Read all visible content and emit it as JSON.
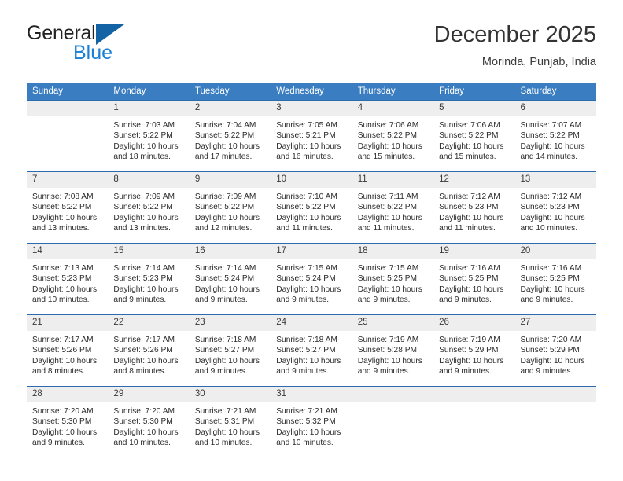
{
  "brand": {
    "line1": "General",
    "line2": "Blue",
    "triangle_color": "#1464a5",
    "blue_text_color": "#1b7fd4"
  },
  "header": {
    "title": "December 2025",
    "subtitle": "Morinda, Punjab, India"
  },
  "theme": {
    "header_bar_color": "#3a7dc0",
    "row_divider_color": "#2c6cae",
    "daynum_band_color": "#eeeeee"
  },
  "weekday_headers": [
    "Sunday",
    "Monday",
    "Tuesday",
    "Wednesday",
    "Thursday",
    "Friday",
    "Saturday"
  ],
  "weeks": [
    [
      {
        "day": "",
        "sunrise": "",
        "sunset": "",
        "daylight": ""
      },
      {
        "day": "1",
        "sunrise": "Sunrise: 7:03 AM",
        "sunset": "Sunset: 5:22 PM",
        "daylight": "Daylight: 10 hours and 18 minutes."
      },
      {
        "day": "2",
        "sunrise": "Sunrise: 7:04 AM",
        "sunset": "Sunset: 5:22 PM",
        "daylight": "Daylight: 10 hours and 17 minutes."
      },
      {
        "day": "3",
        "sunrise": "Sunrise: 7:05 AM",
        "sunset": "Sunset: 5:21 PM",
        "daylight": "Daylight: 10 hours and 16 minutes."
      },
      {
        "day": "4",
        "sunrise": "Sunrise: 7:06 AM",
        "sunset": "Sunset: 5:22 PM",
        "daylight": "Daylight: 10 hours and 15 minutes."
      },
      {
        "day": "5",
        "sunrise": "Sunrise: 7:06 AM",
        "sunset": "Sunset: 5:22 PM",
        "daylight": "Daylight: 10 hours and 15 minutes."
      },
      {
        "day": "6",
        "sunrise": "Sunrise: 7:07 AM",
        "sunset": "Sunset: 5:22 PM",
        "daylight": "Daylight: 10 hours and 14 minutes."
      }
    ],
    [
      {
        "day": "7",
        "sunrise": "Sunrise: 7:08 AM",
        "sunset": "Sunset: 5:22 PM",
        "daylight": "Daylight: 10 hours and 13 minutes."
      },
      {
        "day": "8",
        "sunrise": "Sunrise: 7:09 AM",
        "sunset": "Sunset: 5:22 PM",
        "daylight": "Daylight: 10 hours and 13 minutes."
      },
      {
        "day": "9",
        "sunrise": "Sunrise: 7:09 AM",
        "sunset": "Sunset: 5:22 PM",
        "daylight": "Daylight: 10 hours and 12 minutes."
      },
      {
        "day": "10",
        "sunrise": "Sunrise: 7:10 AM",
        "sunset": "Sunset: 5:22 PM",
        "daylight": "Daylight: 10 hours and 11 minutes."
      },
      {
        "day": "11",
        "sunrise": "Sunrise: 7:11 AM",
        "sunset": "Sunset: 5:22 PM",
        "daylight": "Daylight: 10 hours and 11 minutes."
      },
      {
        "day": "12",
        "sunrise": "Sunrise: 7:12 AM",
        "sunset": "Sunset: 5:23 PM",
        "daylight": "Daylight: 10 hours and 11 minutes."
      },
      {
        "day": "13",
        "sunrise": "Sunrise: 7:12 AM",
        "sunset": "Sunset: 5:23 PM",
        "daylight": "Daylight: 10 hours and 10 minutes."
      }
    ],
    [
      {
        "day": "14",
        "sunrise": "Sunrise: 7:13 AM",
        "sunset": "Sunset: 5:23 PM",
        "daylight": "Daylight: 10 hours and 10 minutes."
      },
      {
        "day": "15",
        "sunrise": "Sunrise: 7:14 AM",
        "sunset": "Sunset: 5:23 PM",
        "daylight": "Daylight: 10 hours and 9 minutes."
      },
      {
        "day": "16",
        "sunrise": "Sunrise: 7:14 AM",
        "sunset": "Sunset: 5:24 PM",
        "daylight": "Daylight: 10 hours and 9 minutes."
      },
      {
        "day": "17",
        "sunrise": "Sunrise: 7:15 AM",
        "sunset": "Sunset: 5:24 PM",
        "daylight": "Daylight: 10 hours and 9 minutes."
      },
      {
        "day": "18",
        "sunrise": "Sunrise: 7:15 AM",
        "sunset": "Sunset: 5:25 PM",
        "daylight": "Daylight: 10 hours and 9 minutes."
      },
      {
        "day": "19",
        "sunrise": "Sunrise: 7:16 AM",
        "sunset": "Sunset: 5:25 PM",
        "daylight": "Daylight: 10 hours and 9 minutes."
      },
      {
        "day": "20",
        "sunrise": "Sunrise: 7:16 AM",
        "sunset": "Sunset: 5:25 PM",
        "daylight": "Daylight: 10 hours and 9 minutes."
      }
    ],
    [
      {
        "day": "21",
        "sunrise": "Sunrise: 7:17 AM",
        "sunset": "Sunset: 5:26 PM",
        "daylight": "Daylight: 10 hours and 8 minutes."
      },
      {
        "day": "22",
        "sunrise": "Sunrise: 7:17 AM",
        "sunset": "Sunset: 5:26 PM",
        "daylight": "Daylight: 10 hours and 8 minutes."
      },
      {
        "day": "23",
        "sunrise": "Sunrise: 7:18 AM",
        "sunset": "Sunset: 5:27 PM",
        "daylight": "Daylight: 10 hours and 9 minutes."
      },
      {
        "day": "24",
        "sunrise": "Sunrise: 7:18 AM",
        "sunset": "Sunset: 5:27 PM",
        "daylight": "Daylight: 10 hours and 9 minutes."
      },
      {
        "day": "25",
        "sunrise": "Sunrise: 7:19 AM",
        "sunset": "Sunset: 5:28 PM",
        "daylight": "Daylight: 10 hours and 9 minutes."
      },
      {
        "day": "26",
        "sunrise": "Sunrise: 7:19 AM",
        "sunset": "Sunset: 5:29 PM",
        "daylight": "Daylight: 10 hours and 9 minutes."
      },
      {
        "day": "27",
        "sunrise": "Sunrise: 7:20 AM",
        "sunset": "Sunset: 5:29 PM",
        "daylight": "Daylight: 10 hours and 9 minutes."
      }
    ],
    [
      {
        "day": "28",
        "sunrise": "Sunrise: 7:20 AM",
        "sunset": "Sunset: 5:30 PM",
        "daylight": "Daylight: 10 hours and 9 minutes."
      },
      {
        "day": "29",
        "sunrise": "Sunrise: 7:20 AM",
        "sunset": "Sunset: 5:30 PM",
        "daylight": "Daylight: 10 hours and 10 minutes."
      },
      {
        "day": "30",
        "sunrise": "Sunrise: 7:21 AM",
        "sunset": "Sunset: 5:31 PM",
        "daylight": "Daylight: 10 hours and 10 minutes."
      },
      {
        "day": "31",
        "sunrise": "Sunrise: 7:21 AM",
        "sunset": "Sunset: 5:32 PM",
        "daylight": "Daylight: 10 hours and 10 minutes."
      },
      {
        "day": "",
        "sunrise": "",
        "sunset": "",
        "daylight": ""
      },
      {
        "day": "",
        "sunrise": "",
        "sunset": "",
        "daylight": ""
      },
      {
        "day": "",
        "sunrise": "",
        "sunset": "",
        "daylight": ""
      }
    ]
  ]
}
